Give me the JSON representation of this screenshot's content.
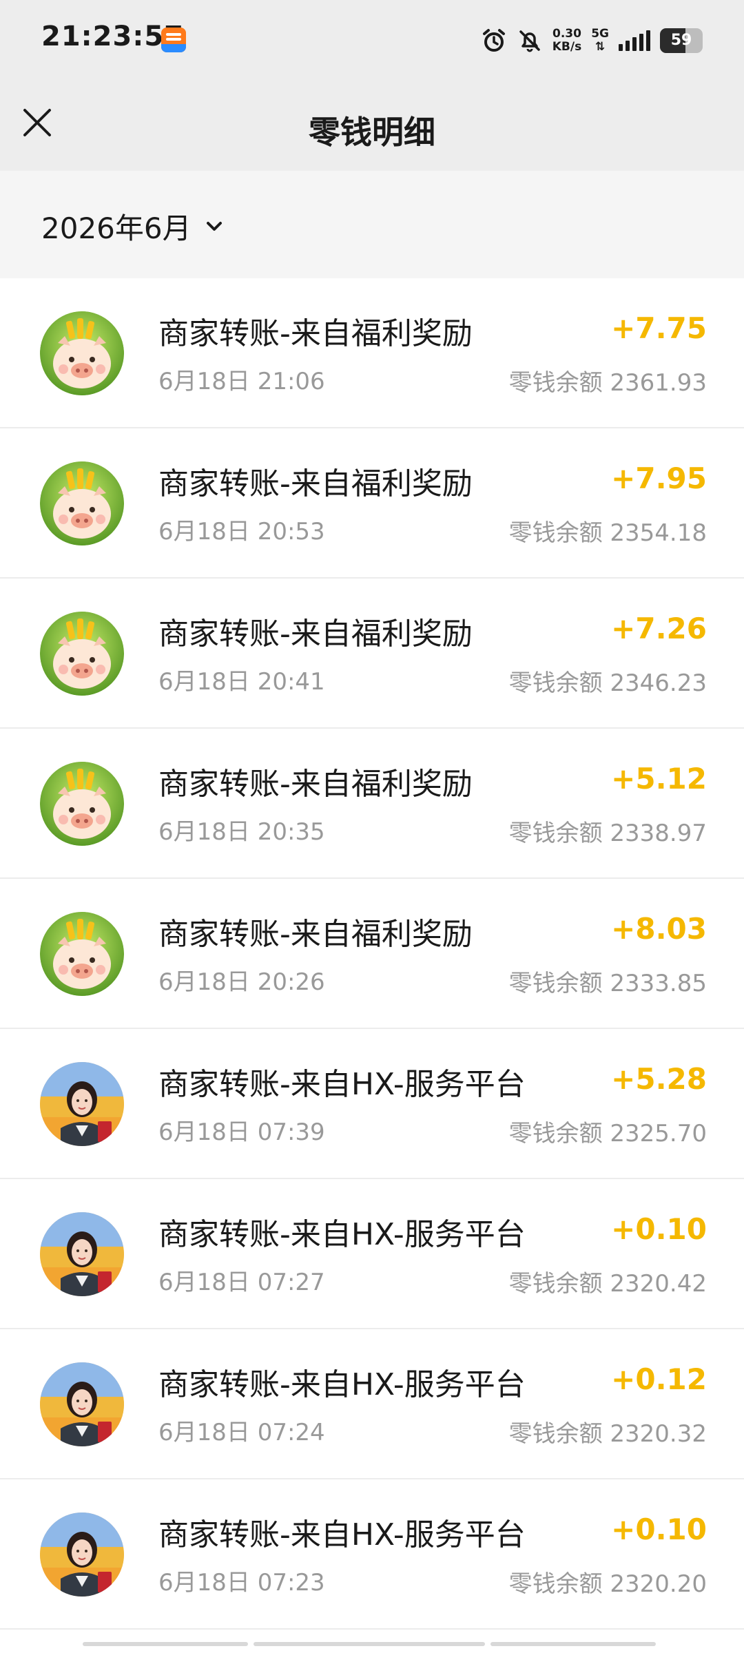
{
  "status_bar": {
    "time": "21:23:57",
    "app_badge": "淘宝闪购",
    "net_speed_value": "0.30",
    "net_speed_unit": "KB/s",
    "network_type": "5G",
    "battery_level": "59",
    "battery_fraction": 0.59,
    "icons": [
      "alarm-icon",
      "mute-bell-icon",
      "signal-icon",
      "battery-icon"
    ]
  },
  "nav": {
    "title": "零钱明细",
    "close_icon": "close-icon"
  },
  "filter": {
    "month": "2026年6月",
    "chevron_icon": "chevron-down-icon"
  },
  "colors": {
    "amount": "#f5b800",
    "header_bg": "#ededed",
    "month_bg": "#f5f5f5",
    "secondary_text": "#999999"
  },
  "transactions": [
    {
      "title": "商家转账-来自福利奖励",
      "time": "6月18日 21:06",
      "amount": "+7.75",
      "balance": "零钱余额 2361.93",
      "avatar": "pig-avatar"
    },
    {
      "title": "商家转账-来自福利奖励",
      "time": "6月18日 20:53",
      "amount": "+7.95",
      "balance": "零钱余额 2354.18",
      "avatar": "pig-avatar"
    },
    {
      "title": "商家转账-来自福利奖励",
      "time": "6月18日 20:41",
      "amount": "+7.26",
      "balance": "零钱余额 2346.23",
      "avatar": "pig-avatar"
    },
    {
      "title": "商家转账-来自福利奖励",
      "time": "6月18日 20:35",
      "amount": "+5.12",
      "balance": "零钱余额 2338.97",
      "avatar": "pig-avatar"
    },
    {
      "title": "商家转账-来自福利奖励",
      "time": "6月18日 20:26",
      "amount": "+8.03",
      "balance": "零钱余额 2333.85",
      "avatar": "pig-avatar"
    },
    {
      "title": "商家转账-来自HX-服务平台",
      "time": "6月18日 07:39",
      "amount": "+5.28",
      "balance": "零钱余额 2325.70",
      "avatar": "woman-avatar"
    },
    {
      "title": "商家转账-来自HX-服务平台",
      "time": "6月18日 07:27",
      "amount": "+0.10",
      "balance": "零钱余额 2320.42",
      "avatar": "woman-avatar"
    },
    {
      "title": "商家转账-来自HX-服务平台",
      "time": "6月18日 07:24",
      "amount": "+0.12",
      "balance": "零钱余额 2320.32",
      "avatar": "woman-avatar"
    },
    {
      "title": "商家转账-来自HX-服务平台",
      "time": "6月18日 07:23",
      "amount": "+0.10",
      "balance": "零钱余额 2320.20",
      "avatar": "woman-avatar"
    }
  ]
}
